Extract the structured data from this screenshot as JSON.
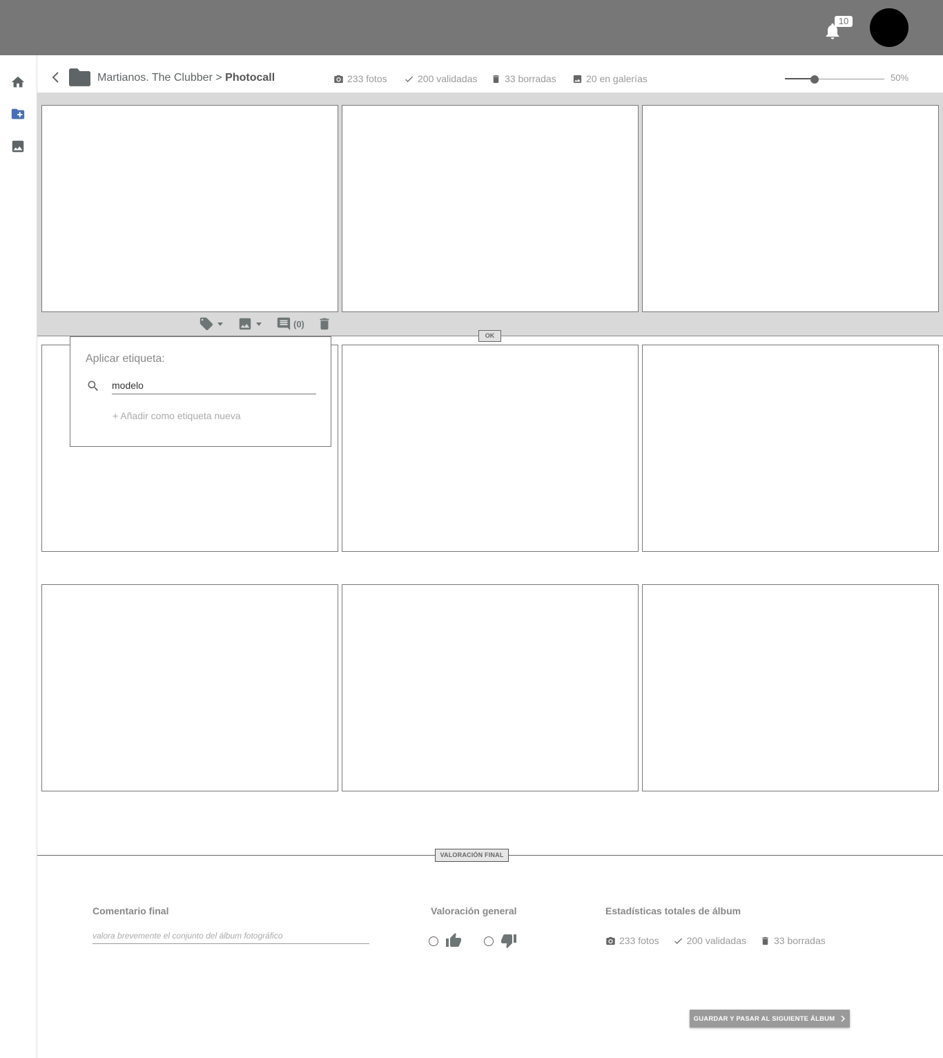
{
  "topbar": {
    "notification_count": "10"
  },
  "breadcrumb": {
    "album": "Martianos. The Clubber",
    "separator": ">",
    "section": "Photocall"
  },
  "stats": {
    "fotos": "233 fotos",
    "validadas": "200 validadas",
    "borradas": "33 borradas",
    "galerias": "20 en galerías"
  },
  "zoom": {
    "value": 50,
    "label": "50%"
  },
  "photo_toolbar": {
    "comments_label": "(0)",
    "ok_label": "OK"
  },
  "tag_popover": {
    "title": "Aplicar etiqueta:",
    "search_value": "modelo",
    "add_new_label": "+ Añadir como etiqueta nueva"
  },
  "final": {
    "section_label": "VALORACIÓN FINAL",
    "comment_title": "Comentario final",
    "comment_placeholder": "valora brevemente el conjunto del álbum fotográfico",
    "rating_title": "Valoración general",
    "stats_title": "Estadísticas totales de álbum",
    "stats": {
      "fotos": "233 fotos",
      "validadas": "200 validadas",
      "borradas": "33 borradas"
    },
    "save_label": "GUARDAR Y PASAR AL SIGUIENTE ÁLBUM"
  },
  "colors": {
    "topbar": "#777777",
    "accent_icon": "#4a6fb5",
    "selection_bg": "#d9d9d9"
  }
}
